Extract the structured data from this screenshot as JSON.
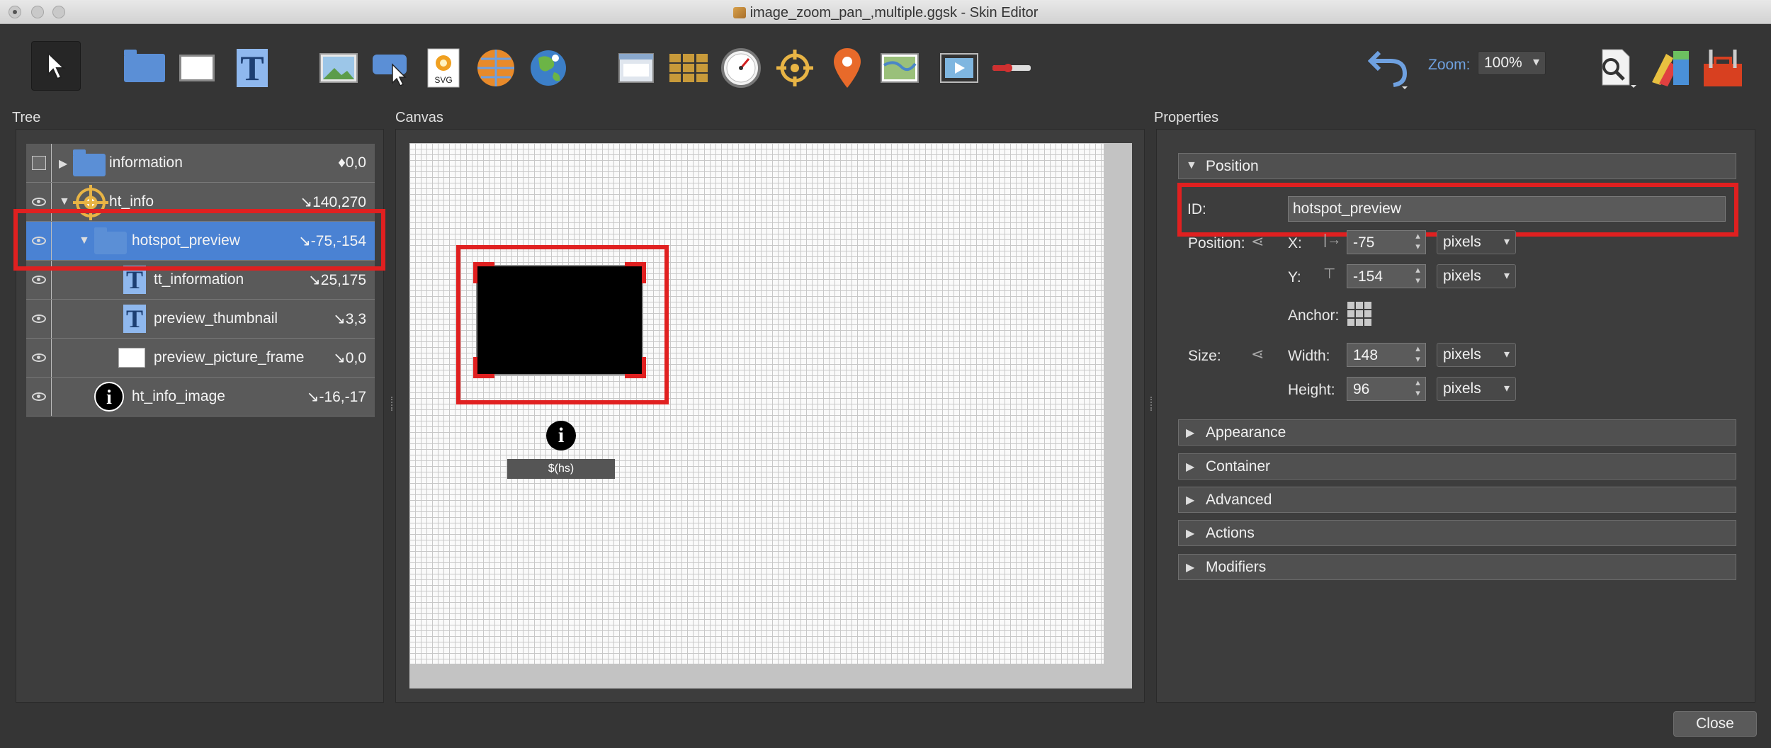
{
  "window": {
    "title": "image_zoom_pan_,multiple.ggsk - Skin Editor"
  },
  "toolbar": {
    "tools": [
      {
        "name": "select-tool",
        "icon": "pointer-arrow-icon"
      },
      {
        "name": "container-tool",
        "icon": "folder-icon"
      },
      {
        "name": "rectangle-tool",
        "icon": "rectangle-icon"
      },
      {
        "name": "text-tool",
        "icon": "text-t-icon"
      },
      {
        "name": "image-tool",
        "icon": "image-icon"
      },
      {
        "name": "button-tool",
        "icon": "button-cursor-icon"
      },
      {
        "name": "svg-tool",
        "icon": "svg-icon"
      },
      {
        "name": "hotspot-tool",
        "icon": "hotspot-icon"
      },
      {
        "name": "map-tool",
        "icon": "globe-icon"
      },
      {
        "name": "text-box-tool",
        "icon": "text-box-icon"
      },
      {
        "name": "cloner-tool",
        "icon": "cloner-grid-icon"
      },
      {
        "name": "timer-tool",
        "icon": "timer-icon"
      },
      {
        "name": "hotspot-proxy-tool",
        "icon": "target-icon"
      },
      {
        "name": "map-pin-tool",
        "icon": "map-pin-icon"
      },
      {
        "name": "floorplan-tool",
        "icon": "map-image-icon"
      },
      {
        "name": "video-tool",
        "icon": "video-icon"
      },
      {
        "name": "progressbar-tool",
        "icon": "slider-icon"
      }
    ],
    "undo_icon": "undo-icon",
    "zoom_label": "Zoom:",
    "zoom_value": "100%",
    "right_icons": [
      "search-icon",
      "color-tools-icon",
      "toolbox-icon"
    ]
  },
  "tree": {
    "label": "Tree",
    "rows": [
      {
        "label": "information",
        "coords": "♦0,0",
        "icon": "folder-icon",
        "visible_icon": "checkbox"
      },
      {
        "label": "ht_info",
        "coords": "↘140,270",
        "icon": "hotspot-icon",
        "visible_icon": "eye-icon"
      },
      {
        "label": "hotspot_preview",
        "coords": "↘-75,-154",
        "icon": "folder-icon",
        "visible_icon": "eye-icon",
        "selected": true
      },
      {
        "label": "tt_information",
        "coords": "↘25,175",
        "icon": "text-t-icon",
        "visible_icon": "eye-icon"
      },
      {
        "label": "preview_thumbnail",
        "coords": "↘3,3",
        "icon": "text-t-icon",
        "visible_icon": "eye-icon"
      },
      {
        "label": "preview_picture_frame",
        "coords": "↘0,0",
        "icon": "rectangle-icon",
        "visible_icon": "eye-icon"
      },
      {
        "label": "ht_info_image",
        "coords": "↘-16,-17",
        "icon": "info-icon",
        "visible_icon": "eye-icon"
      }
    ]
  },
  "canvas": {
    "label": "Canvas",
    "info_glyph": "i",
    "hs_text": "$(hs)"
  },
  "properties": {
    "label": "Properties",
    "sections": {
      "position": "Position",
      "appearance": "Appearance",
      "container": "Container",
      "advanced": "Advanced",
      "actions": "Actions",
      "modifiers": "Modifiers"
    },
    "id_label": "ID:",
    "id_value": "hotspot_preview",
    "position_label": "Position:",
    "x_label": "X:",
    "x_value": "-75",
    "x_unit": "pixels",
    "y_label": "Y:",
    "y_value": "-154",
    "y_unit": "pixels",
    "anchor_label": "Anchor:",
    "size_label": "Size:",
    "width_label": "Width:",
    "width_value": "148",
    "width_unit": "pixels",
    "height_label": "Height:",
    "height_value": "96",
    "height_unit": "pixels"
  },
  "footer": {
    "close_label": "Close"
  },
  "colors": {
    "highlight": "#e02020",
    "selection": "#4a82d3",
    "accent_blue": "#6fa1e0"
  }
}
